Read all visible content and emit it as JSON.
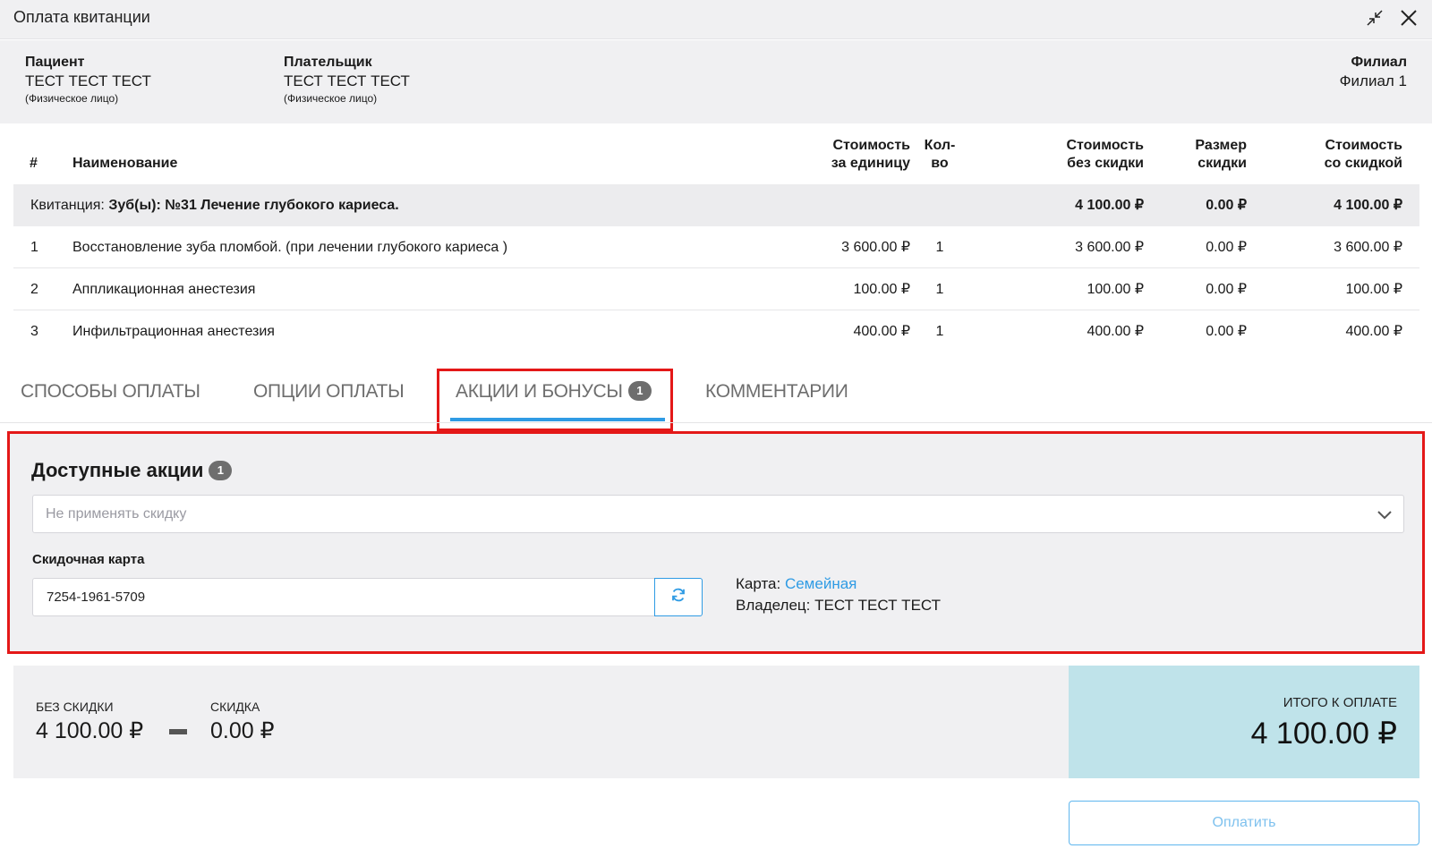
{
  "window": {
    "title": "Оплата квитанции",
    "collapse_icon": "collapse-arrows-icon",
    "close_icon": "close-icon"
  },
  "info": {
    "patient": {
      "label": "Пациент",
      "name": "ТЕСТ ТЕСТ ТЕСТ",
      "type": "(Физическое лицо)"
    },
    "payer": {
      "label": "Плательщик",
      "name": "ТЕСТ ТЕСТ ТЕСТ",
      "type": "(Физическое лицо)"
    },
    "branch": {
      "label": "Филиал",
      "name": "Филиал 1"
    }
  },
  "table": {
    "headers": {
      "num": "#",
      "name": "Наименование",
      "unit_price_1": "Стоимость",
      "unit_price_2": "за единицу",
      "qty_1": "Кол-",
      "qty_2": "во",
      "no_discount_1": "Стоимость",
      "no_discount_2": "без скидки",
      "discount_1": "Размер",
      "discount_2": "скидки",
      "with_discount_1": "Стоимость",
      "with_discount_2": "со скидкой"
    },
    "group": {
      "prefix": "Квитанция:",
      "title": "Зуб(ы): №31 Лечение глубокого кариеса.",
      "no_discount": "4 100.00 ₽",
      "discount": "0.00 ₽",
      "with_discount": "4 100.00 ₽"
    },
    "rows": [
      {
        "num": "1",
        "name": "Восстановление зуба пломбой. (при лечении глубокого кариеса )",
        "unit_price": "3 600.00 ₽",
        "qty": "1",
        "no_discount": "3 600.00 ₽",
        "discount": "0.00 ₽",
        "with_discount": "3 600.00 ₽"
      },
      {
        "num": "2",
        "name": "Аппликационная анестезия",
        "unit_price": "100.00 ₽",
        "qty": "1",
        "no_discount": "100.00 ₽",
        "discount": "0.00 ₽",
        "with_discount": "100.00 ₽"
      },
      {
        "num": "3",
        "name": "Инфильтрационная анестезия",
        "unit_price": "400.00 ₽",
        "qty": "1",
        "no_discount": "400.00 ₽",
        "discount": "0.00 ₽",
        "with_discount": "400.00 ₽"
      }
    ]
  },
  "tabs": [
    {
      "label": "СПОСОБЫ ОПЛАТЫ"
    },
    {
      "label": "ОПЦИИ ОПЛАТЫ"
    },
    {
      "label": "АКЦИИ И БОНУСЫ",
      "badge": "1",
      "active": true
    },
    {
      "label": "КОММЕНТАРИИ"
    }
  ],
  "promo": {
    "title": "Доступные акции",
    "badge": "1",
    "select_placeholder": "Не применять скидку",
    "card_label": "Скидочная карта",
    "card_number": "7254-1961-5709",
    "card_type_label": "Карта:",
    "card_type_value": "Семейная",
    "owner_label": "Владелец:",
    "owner_value": "ТЕСТ ТЕСТ ТЕСТ"
  },
  "summary": {
    "no_discount_label": "БЕЗ СКИДКИ",
    "no_discount_value": "4 100.00 ₽",
    "discount_label": "СКИДКА",
    "discount_value": "0.00 ₽",
    "total_label": "ИТОГО К ОПЛАТЕ",
    "total_value": "4 100.00 ₽"
  },
  "pay_button": "Оплатить",
  "colors": {
    "accent": "#2f9be4",
    "highlight": "#e41818",
    "total_bg": "#bfe3ea",
    "panel_bg": "#f0f0f2"
  }
}
